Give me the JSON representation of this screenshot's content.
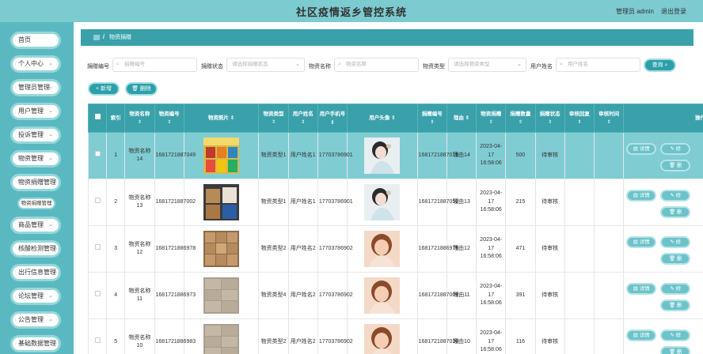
{
  "header": {
    "title": "社区疫情返乡管控系统",
    "admin_label": "管理员 admin",
    "logout_label": "退出登录"
  },
  "sidebar": {
    "items": [
      {
        "label": "首页",
        "has_chevron": false
      },
      {
        "label": "个人中心",
        "has_chevron": true
      },
      {
        "label": "管理员管理",
        "has_chevron": true
      },
      {
        "label": "用户管理",
        "has_chevron": true
      },
      {
        "label": "投诉管理",
        "has_chevron": true
      },
      {
        "label": "物资管理",
        "has_chevron": true
      },
      {
        "label": "物资捐赠管理",
        "has_chevron": false
      },
      {
        "label": "商品管理",
        "has_chevron": true
      },
      {
        "label": "核酸检测管理",
        "has_chevron": false
      },
      {
        "label": "出行信息管理",
        "has_chevron": false
      },
      {
        "label": "论坛管理",
        "has_chevron": true
      },
      {
        "label": "公告管理",
        "has_chevron": true
      },
      {
        "label": "基础数据管理",
        "has_chevron": false
      }
    ],
    "submenu": {
      "label": "物资捐赠管理"
    }
  },
  "breadcrumb": {
    "current": "物资捐赠"
  },
  "filters": {
    "donation_no": {
      "label": "捐赠编号",
      "placeholder": "捐赠编号"
    },
    "donation_status": {
      "label": "捐赠状态",
      "placeholder": "请选择捐赠状态"
    },
    "goods_name": {
      "label": "物资名称",
      "placeholder": "物资名称"
    },
    "goods_type": {
      "label": "物资类型",
      "placeholder": "请选择物资类型"
    },
    "user_name": {
      "label": "用户姓名",
      "placeholder": "用户姓名"
    },
    "query_button": "查询"
  },
  "actions": {
    "add": "新增",
    "delete": "删除"
  },
  "table": {
    "headers": [
      "索引",
      "物资名称",
      "物资编号",
      "物资照片",
      "物资类型",
      "用户姓名",
      "用户手机号",
      "用户头像",
      "捐赠编号",
      "理由",
      "物资捐赠",
      "捐赠数量",
      "捐赠状态",
      "审核回复",
      "审核时间",
      "操作"
    ],
    "row_actions": {
      "detail": "详情",
      "edit": "修",
      "delete": "删"
    },
    "rows": [
      {
        "index": "1",
        "goods_name": "物资名称14",
        "goods_no": "1681721887049",
        "goods_type": "物资类型1",
        "user_name": "用户姓名1",
        "phone": "17703786901",
        "donation_no": "1681721887015",
        "reason": "理由14",
        "time": "2023-04-17 16:58:06",
        "quantity": "500",
        "status": "待审核",
        "review_reply": "",
        "review_time": "",
        "selected": true,
        "goods_img": "boxes-yellow-icon",
        "avatar": "woman-avatar-icon"
      },
      {
        "index": "2",
        "goods_name": "物资名称13",
        "goods_no": "1681721887002",
        "goods_type": "物资类型1",
        "user_name": "用户姓名1",
        "phone": "17703786901",
        "donation_no": "1681721887052",
        "reason": "理由13",
        "time": "2023-04-17 16:58:06",
        "quantity": "215",
        "status": "待审核",
        "review_reply": "",
        "review_time": "",
        "selected": false,
        "goods_img": "boxes-dark-icon",
        "avatar": "woman-avatar-icon"
      },
      {
        "index": "3",
        "goods_name": "物资名称12",
        "goods_no": "1681721886978",
        "goods_type": "物资类型2",
        "user_name": "用户姓名2",
        "phone": "17703786902",
        "donation_no": "1681721886975",
        "reason": "理由12",
        "time": "2023-04-17 16:58:06",
        "quantity": "471",
        "status": "待审核",
        "review_reply": "",
        "review_time": "",
        "selected": false,
        "goods_img": "boxes-brown-icon",
        "avatar": "girl-avatar-icon"
      },
      {
        "index": "4",
        "goods_name": "物资名称11",
        "goods_no": "1681721886973",
        "goods_type": "物资类型4",
        "user_name": "用户姓名2",
        "phone": "17703786902",
        "donation_no": "1681721887006",
        "reason": "理由11",
        "time": "2023-04-17 16:58:06",
        "quantity": "391",
        "status": "待审核",
        "review_reply": "",
        "review_time": "",
        "selected": false,
        "goods_img": "boxes-stack-icon",
        "avatar": "girl-avatar-icon"
      },
      {
        "index": "5",
        "goods_name": "物资名称10",
        "goods_no": "1681721886983",
        "goods_type": "物资类型2",
        "user_name": "用户姓名2",
        "phone": "17703786902",
        "donation_no": "1681721887030",
        "reason": "理由10",
        "time": "2023-04-17 16:58:06",
        "quantity": "116",
        "status": "待审核",
        "review_reply": "",
        "review_time": "",
        "selected": false,
        "goods_img": "boxes-stack-icon",
        "avatar": "girl-avatar-icon"
      }
    ]
  },
  "colors": {
    "header_bg": "#7ccbd0",
    "sidebar_bg": "#5ab8c0",
    "accent": "#3aa1ab",
    "selected_row": "#7fcdd3"
  }
}
